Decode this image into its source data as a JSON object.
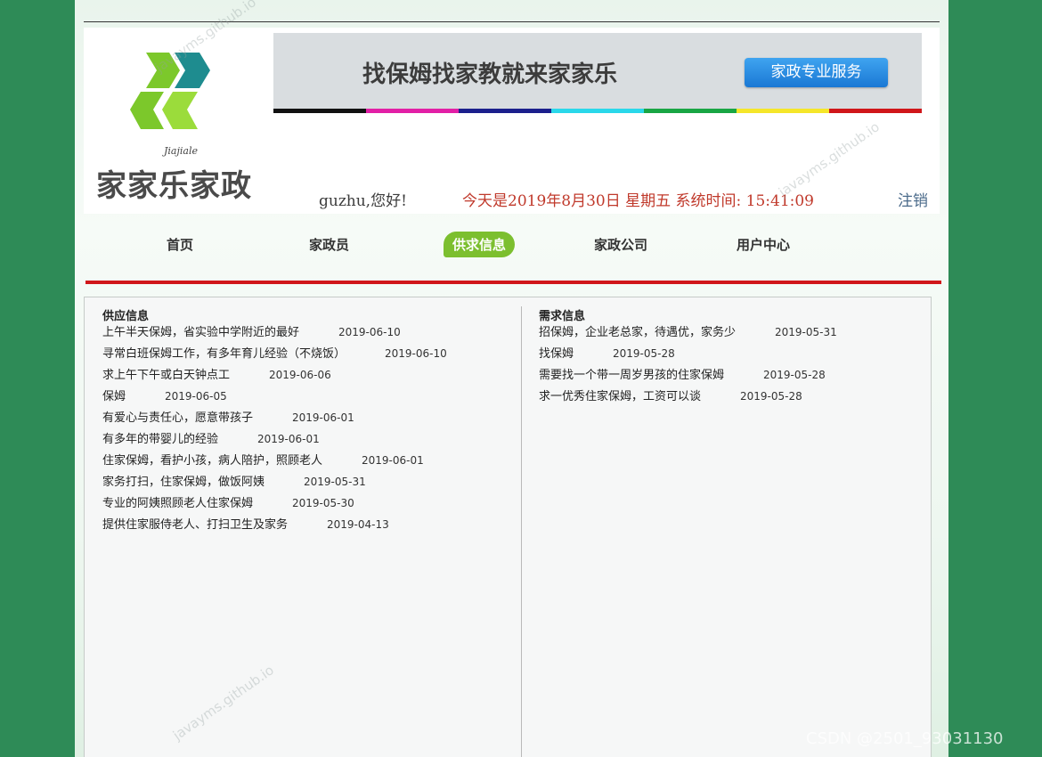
{
  "brand": {
    "logo_sub": "Jiajiale",
    "name": "家家乐家政"
  },
  "banner": {
    "title": "找保姆找家教就来家家乐",
    "button": "家政专业服务",
    "stripe_colors": [
      "#111111",
      "#e21fa6",
      "#1b1f8c",
      "#2ad8ea",
      "#19a644",
      "#f5e62a",
      "#d0161a"
    ]
  },
  "status": {
    "greeting": "guzhu,您好!",
    "datetime": "今天是2019年8月30日 星期五 系统时间: 15:41:09",
    "logout": "注销"
  },
  "nav": [
    {
      "label": "首页"
    },
    {
      "label": "家政员"
    },
    {
      "label": "供求信息",
      "active": true
    },
    {
      "label": "家政公司"
    },
    {
      "label": "用户中心"
    }
  ],
  "supply": {
    "title": "供应信息",
    "items": [
      {
        "text": "上午半天保姆，省实验中学附近的最好",
        "date": "2019-06-10"
      },
      {
        "text": "寻常白班保姆工作，有多年育儿经验（不烧饭）",
        "date": "2019-06-10"
      },
      {
        "text": "求上午下午或白天钟点工",
        "date": "2019-06-06"
      },
      {
        "text": "保姆",
        "date": "2019-06-05"
      },
      {
        "text": "有爱心与责任心，愿意带孩子",
        "date": "2019-06-01"
      },
      {
        "text": "有多年的带婴儿的经验",
        "date": "2019-06-01"
      },
      {
        "text": "住家保姆，看护小孩，病人陪护，照顾老人",
        "date": "2019-06-01"
      },
      {
        "text": "家务打扫，住家保姆，做饭阿姨",
        "date": "2019-05-31"
      },
      {
        "text": "专业的阿姨照顾老人住家保姆",
        "date": "2019-05-30"
      },
      {
        "text": "提供住家服侍老人、打扫卫生及家务",
        "date": "2019-04-13"
      }
    ]
  },
  "demand": {
    "title": "需求信息",
    "items": [
      {
        "text": "招保姆，企业老总家，待遇优，家务少",
        "date": "2019-05-31"
      },
      {
        "text": "找保姆",
        "date": "2019-05-28"
      },
      {
        "text": "需要找一个带一周岁男孩的住家保姆",
        "date": "2019-05-28"
      },
      {
        "text": "求一优秀住家保姆，工资可以谈",
        "date": "2019-05-28"
      }
    ]
  },
  "watermark": "javayms.github.io",
  "footer_credit": "CSDN @2501_93031130"
}
